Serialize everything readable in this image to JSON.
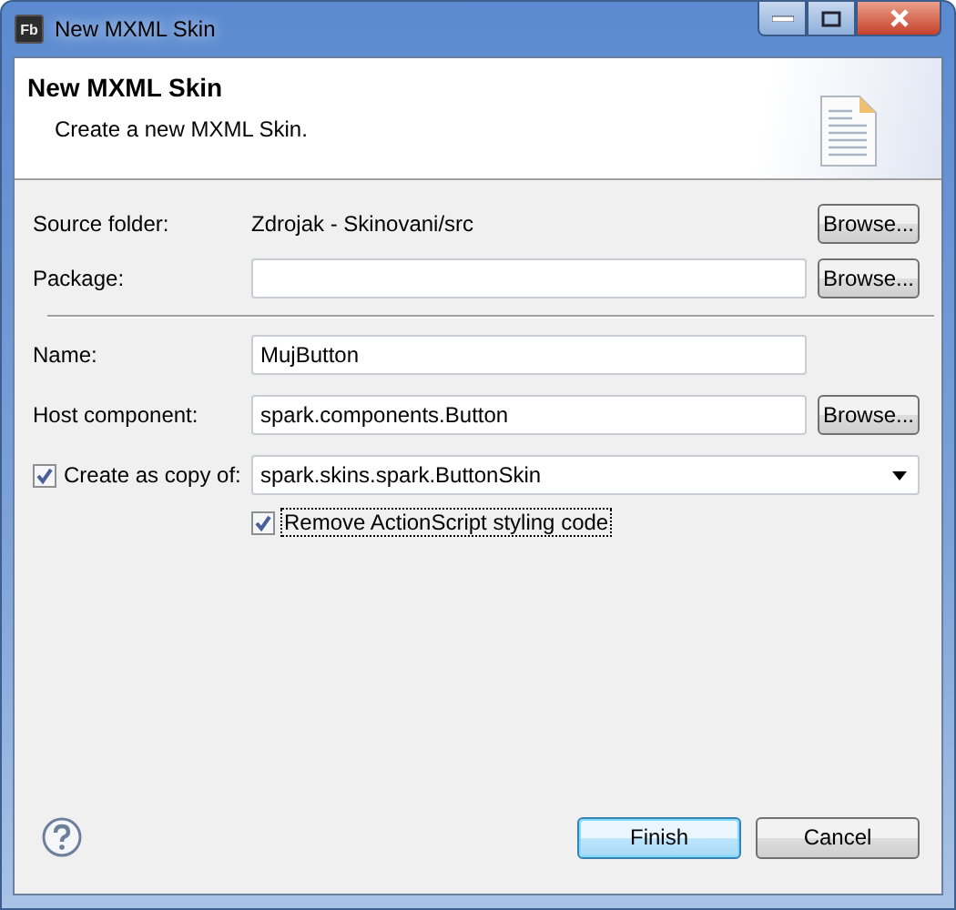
{
  "window": {
    "title": "New MXML Skin",
    "app_icon": "Fb"
  },
  "header": {
    "title": "New MXML Skin",
    "description": "Create a new MXML Skin."
  },
  "groups": [
    [
      {
        "kind": "static",
        "label": "Source folder:",
        "value": "Zdrojak - Skinovani/src",
        "button": "Browse..."
      },
      {
        "kind": "text",
        "label": "Package:",
        "button": "Browse..."
      }
    ],
    [
      {
        "kind": "text",
        "label": "Name:",
        "value": "MujButton"
      },
      {
        "kind": "text",
        "label": "Host component:",
        "value": "spark.components.Button",
        "button": "Browse..."
      },
      {
        "kind": "combo",
        "label": "Create as copy of:",
        "checked": true,
        "value": "spark.skins.spark.ButtonSkin"
      },
      {
        "kind": "check",
        "label": "Remove ActionScript styling code",
        "checked": true,
        "focused": true
      }
    ]
  ],
  "footer": {
    "buttons": [
      {
        "label": "Finish",
        "default": true
      },
      {
        "label": "Cancel",
        "default": false
      }
    ]
  }
}
